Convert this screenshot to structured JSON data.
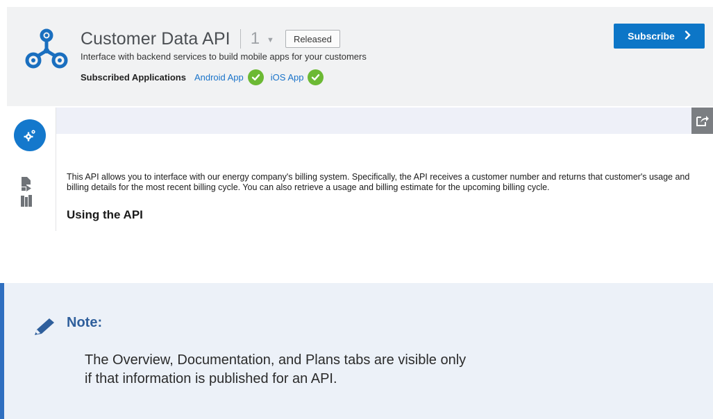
{
  "header": {
    "title": "Customer Data API",
    "version": "1",
    "status": "Released",
    "description": "Interface with backend services to build mobile apps for your customers",
    "subscribed_label": "Subscribed Applications",
    "apps": [
      {
        "name": "Android App",
        "status_icon": "check-circle-icon"
      },
      {
        "name": "iOS App",
        "status_icon": "check-circle-icon"
      }
    ],
    "subscribe_label": "Subscribe",
    "subscribe_icon": "chevron-right-icon"
  },
  "nav": {
    "items": [
      {
        "name": "overview",
        "icon": "gear-icon",
        "active": true
      },
      {
        "name": "documentation",
        "icon": "document-icon",
        "active": false
      },
      {
        "name": "plans",
        "icon": "map-icon",
        "active": false
      }
    ]
  },
  "toolbar": {
    "share_icon": "share-icon"
  },
  "content": {
    "overview": "This API allows you to interface with our energy company's billing system. Specifically, the API receives a customer number and returns that customer's usage and billing details for the most recent billing cycle. You can also retrieve a usage and billing estimate for the upcoming billing cycle.",
    "heading": "Using the API"
  },
  "note": {
    "title": "Note:",
    "text": "The Overview, Documentation, and Plans tabs are visible only if that information is published for an API.",
    "icon": "pencil-icon"
  },
  "colors": {
    "accent": "#0d76c7",
    "success": "#6cb934",
    "link": "#1a73c9",
    "note_bar": "#2f6fc0"
  }
}
